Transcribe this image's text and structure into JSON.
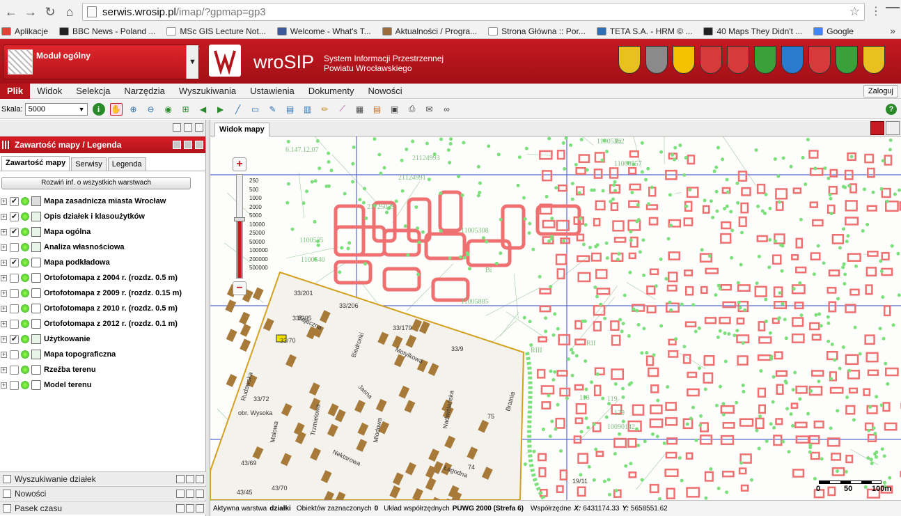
{
  "browser": {
    "url_host": "serwis.wrosip.pl",
    "url_path": "/imap/?gpmap=gp3",
    "bookmarks": [
      {
        "label": "Aplikacje",
        "color": "#e34234"
      },
      {
        "label": "BBC News - Poland ...",
        "color": "#222222"
      },
      {
        "label": "MSc GIS Lecture Not...",
        "color": "#ffffff"
      },
      {
        "label": "Welcome - What's T...",
        "color": "#3b5998"
      },
      {
        "label": "Aktualności / Progra...",
        "color": "#9b6b3b"
      },
      {
        "label": "Strona Główna :: Por...",
        "color": "#ffffff"
      },
      {
        "label": "TETA S.A. - HRM © ...",
        "color": "#2f6fb5"
      },
      {
        "label": "40 Maps They Didn't ...",
        "color": "#222222"
      },
      {
        "label": "Google",
        "color": "#4285f4"
      }
    ],
    "more": "»"
  },
  "header": {
    "module_label": "Moduł ogólny",
    "logo_text": "wroSIP",
    "logo_sub_1": "System Informacji Przestrzennej",
    "logo_sub_2": "Powiatu Wrocławskiego",
    "crests": [
      "#e8c020",
      "#8a8a8a",
      "#f2c200",
      "#d63a3a",
      "#d63a3a",
      "#3aa03a",
      "#2a7ad0",
      "#d63a3a",
      "#3aa03a",
      "#e8c020"
    ]
  },
  "menu": {
    "items": [
      "Plik",
      "Widok",
      "Selekcja",
      "Narzędzia",
      "Wyszukiwania",
      "Ustawienia",
      "Dokumenty",
      "Nowości"
    ],
    "active": 0,
    "login": "Zaloguj"
  },
  "toolbar": {
    "scale_label": "Skala:",
    "scale_value": "5000"
  },
  "left_panel": {
    "title": "Zawartość mapy / Legenda",
    "tabs": [
      "Zawartość mapy",
      "Serwisy",
      "Legenda"
    ],
    "expand_all": "Rozwiń inf. o wszystkich warstwach",
    "layers": [
      {
        "name": "Mapa zasadnicza miasta Wrocław",
        "checked": true,
        "icon": "wms"
      },
      {
        "name": "Opis działek i klasoużytków",
        "checked": true,
        "icon": "img"
      },
      {
        "name": "Mapa ogólna",
        "checked": true,
        "icon": "img"
      },
      {
        "name": "Analiza własnościowa",
        "checked": false,
        "icon": "img"
      },
      {
        "name": "Mapa podkładowa",
        "checked": true,
        "icon": "c"
      },
      {
        "name": "Ortofotomapa z 2004 r. (rozdz. 0.5 m)",
        "checked": false,
        "icon": "c"
      },
      {
        "name": "Ortofotomapa z 2009 r. (rozdz. 0.15 m)",
        "checked": false,
        "icon": "c"
      },
      {
        "name": "Ortofotomapa z 2010 r. (rozdz. 0.5 m)",
        "checked": false,
        "icon": "c"
      },
      {
        "name": "Ortofotomapa z 2012 r. (rozdz. 0.1 m)",
        "checked": false,
        "icon": "c"
      },
      {
        "name": "Użytkowanie",
        "checked": true,
        "icon": "img"
      },
      {
        "name": "Mapa topograficzna",
        "checked": false,
        "icon": "img"
      },
      {
        "name": "Rzeźba terenu",
        "checked": false,
        "icon": "c"
      },
      {
        "name": "Model terenu",
        "checked": false,
        "icon": "c"
      }
    ],
    "bottom_panes": [
      "Wyszukiwanie działek",
      "Nowości",
      "Pasek czasu"
    ]
  },
  "map": {
    "tab_label": "Widok mapy",
    "zoom_levels": [
      "250",
      "500",
      "1000",
      "2000",
      "5000",
      "10000",
      "25000",
      "50000",
      "100000",
      "200000",
      "500000"
    ],
    "zoom_selected_index": 4,
    "scale_labels": [
      "0",
      "50",
      "100m"
    ],
    "parcel_labels": [
      "33/201",
      "33/206",
      "33/205",
      "33/179",
      "33/9",
      "33/70",
      "33/72",
      "43/69",
      "43/45",
      "43/70",
      "75",
      "74",
      "19/11",
      "obr. Wysoka"
    ],
    "street_labels": [
      "Bajeczna",
      "Biedronki",
      "Motylkowa",
      "Jasna",
      "Rudawska",
      "Malowa",
      "Trzmielowa",
      "Nektarowa",
      "Miodowa",
      "Nadwiślańska",
      "Łagodna",
      "Bratnia"
    ],
    "parcel_numbers_faint": [
      "6.147.12.07",
      "21124993",
      "21124991",
      "21125029",
      "11005308",
      "11005362",
      "1100535",
      "1100540",
      "11005885",
      "11060557",
      "119",
      "118",
      "129",
      "10090142",
      "Bz",
      "Bi",
      "RIII",
      "RII"
    ]
  },
  "status": {
    "active_layer_label": "Aktywna warstwa",
    "active_layer_value": "działki",
    "selected_label": "Obiektów zaznaczonych",
    "selected_value": "0",
    "crs_label": "Układ współrzędnych",
    "crs_value": "PUWG 2000 (Strefa 6)",
    "coords_label": "Współrzędne",
    "x_label": "X:",
    "x_value": "6431174.33",
    "y_label": "Y:",
    "y_value": "5658551.62"
  }
}
